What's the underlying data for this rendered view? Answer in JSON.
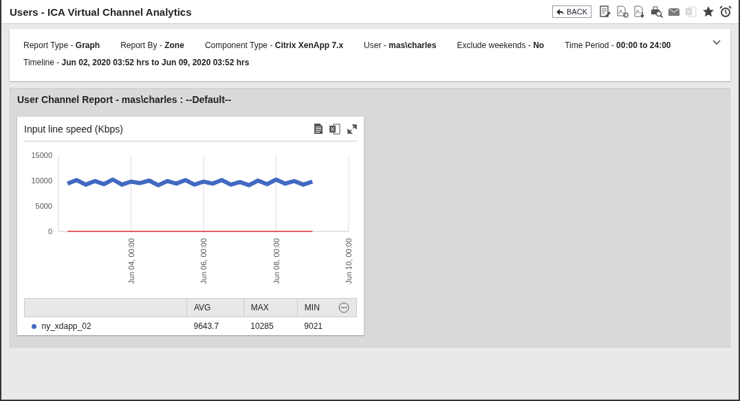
{
  "window": {
    "title": "Users - ICA Virtual Channel Analytics"
  },
  "toolbar": {
    "back_button": "BACK",
    "icons": [
      {
        "kind": "edit-report",
        "disabled": false
      },
      {
        "kind": "pdf-link",
        "disabled": false
      },
      {
        "kind": "pdf-download",
        "disabled": false
      },
      {
        "kind": "print-preview",
        "disabled": false
      },
      {
        "kind": "mail",
        "disabled": false
      },
      {
        "kind": "excel",
        "disabled": true
      },
      {
        "kind": "star",
        "disabled": false
      },
      {
        "kind": "alarm",
        "disabled": false
      }
    ]
  },
  "filters": {
    "expanded": false,
    "items": [
      {
        "label": "Report Type - ",
        "value": "Graph"
      },
      {
        "label": "Report By - ",
        "value": "Zone"
      },
      {
        "label": "Component Type - ",
        "value": "Citrix XenApp 7.x"
      },
      {
        "label": "User - ",
        "value": "mas\\charles"
      },
      {
        "label": "Exclude weekends - ",
        "value": "No"
      },
      {
        "label": "Time Period - ",
        "value": "00:00 to 24:00"
      },
      {
        "label": "Timeline - ",
        "value": "Jun 02, 2020 03:52 hrs to Jun 09, 2020 03:52 hrs"
      }
    ]
  },
  "report": {
    "title": "User Channel Report - mas\\charles : --Default--",
    "widget": {
      "title": "Input line speed (Kbps)",
      "chart_data": {
        "type": "line",
        "categories": [
          null,
          null,
          null,
          null,
          null,
          null,
          null,
          null,
          "Jun 04, 00:00",
          null,
          null,
          null,
          null,
          null,
          null,
          null,
          "Jun 06, 00:00",
          null,
          null,
          null,
          null,
          null,
          null,
          null,
          "Jun 08, 00:00",
          null,
          null,
          null,
          null,
          null,
          null,
          null,
          "Jun 10, 00:00"
        ],
        "series": [
          {
            "color": "#4169c1",
            "values": [
              null,
              9400,
              10100,
              9200,
              9900,
              9300,
              10200,
              9200,
              9800,
              9500,
              10000,
              9100,
              9900,
              9400,
              10100,
              9200,
              9800,
              9400,
              10100,
              9200,
              9700,
              9100,
              10000,
              9300,
              10200,
              9400,
              9900,
              9200,
              9800,
              null,
              null,
              null,
              null
            ]
          },
          {
            "color": "#e8303a",
            "values": [
              null,
              0,
              0,
              0,
              0,
              0,
              0,
              0,
              0,
              0,
              0,
              0,
              0,
              0,
              0,
              0,
              0,
              0,
              0,
              0,
              0,
              0,
              0,
              0,
              0,
              0,
              0,
              0,
              0,
              null,
              null,
              null,
              null
            ]
          }
        ],
        "grid": true,
        "ylim": [
          0,
          15000
        ],
        "yticks": [
          0,
          5000,
          10000,
          15000
        ]
      },
      "legend": {
        "columns": [
          "AVG",
          "MAX",
          "MIN"
        ],
        "rows": [
          {
            "name": "ny_xdapp_02",
            "color": "#4169c1",
            "values": [
              "9643.7",
              "10285",
              "9021"
            ]
          }
        ]
      }
    }
  }
}
